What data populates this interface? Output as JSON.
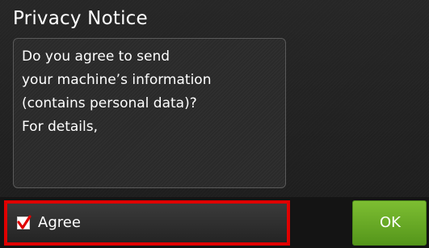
{
  "dialog": {
    "title": "Privacy Notice",
    "message_lines": [
      "Do you agree to send",
      "your machine’s information",
      "(contains personal data)?",
      "For details,"
    ]
  },
  "agree": {
    "label": "Agree",
    "checked": true,
    "highlight_color": "#e00000",
    "check_color": "#e00000"
  },
  "ok": {
    "label": "OK",
    "color": "#6aae28"
  },
  "icons": {
    "checkbox": "checkmark-icon"
  }
}
